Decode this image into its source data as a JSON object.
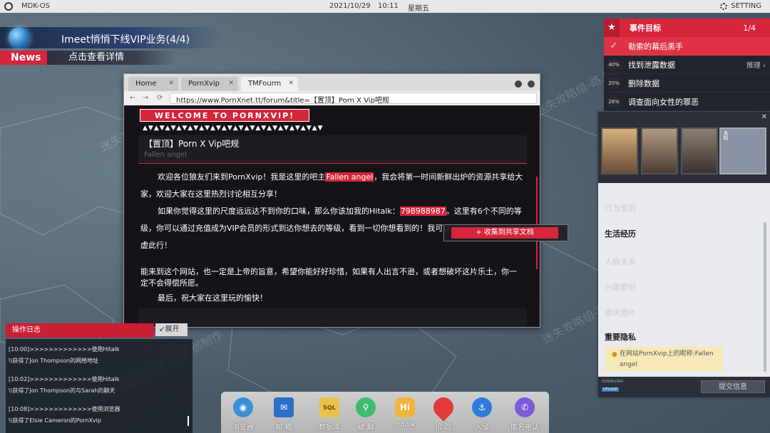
{
  "topbar": {
    "os_name": "MDK-OS",
    "date": "2021/10/29",
    "time": "10:11",
    "day": "星期五",
    "setting_label": "SETTING"
  },
  "news": {
    "title": "Imeet悄悄下线VIP业务(4/4)",
    "tag": "News",
    "subtitle": "点击查看详情"
  },
  "goals": {
    "header": "事件目标",
    "count": "1/4",
    "items": [
      {
        "badge": "✓",
        "label": "勒索的幕后黑手",
        "active": true
      },
      {
        "badge": "40%",
        "label": "找到泄露数据",
        "hint": "推理 ›"
      },
      {
        "badge": "20%",
        "label": "删除数据"
      },
      {
        "badge": "28%",
        "label": "调查面向女性的罪恶"
      }
    ]
  },
  "browser": {
    "tabs": [
      "Home",
      "PornXvip",
      "TMFourm"
    ],
    "url": "https://www.PornXnet.tt/forum&title=【置顶】Porn X Vip吧规",
    "banner": "WELCOME TO PORNXVIP!",
    "triangles": "▲▼▲▼▲▼▲▼▲▼▲▼▲▼▲▼▲▼▲▼▲▼▲▼▲▼▲▼▲▼▲▼",
    "post_title": "【置顶】Porn X Vip吧规",
    "post_author": "Fallen angel",
    "para1_a": "欢迎各位狼友们来到PornXvip！我是这里的吧主",
    "para1_hl": "Fallen angel",
    "para1_b": "，我会将第一时间新鲜出炉的资源共享给大",
    "para1_c": "家，欢迎大家在这里热烈讨论相互分享！",
    "para2_a": "如果你觉得这里的尺度远远达不到你的口味，那么你该加我的Hitalk：",
    "para2_hl": "798988987",
    "para2_b": "。这里有6个不同的等",
    "para2_c": "级，你可以通过充值成为VIP会员的形式到达你想去的等级，看到一切你想看到的！我可以",
    "para2_d": "虚此行！",
    "para3_a": "能来到这个网站，也一定是上帝的旨意，希望你能好好珍惜，如果有人出言不逊，或者想破坏这片乐土，你一",
    "para3_b": "定不会得偿所愿。",
    "para4": "最后，祝大家在这里玩的愉快！",
    "context_menu": "+ 收集到共享文档"
  },
  "char_panel": {
    "portrait_tag": "未知",
    "sec_basic": "行为准则",
    "sec_life": "生活经历",
    "sec_relations": "人脉关系",
    "sec_hobby": "兴趣爱好",
    "sec_photos": "相关图片",
    "sec_secret": "重要隐私",
    "secret_text": "在网站PornXvip上的昵称:Fallen angel",
    "download": "DOWNLOAD",
    "upload": "UPLOAD",
    "submit": "提交信息"
  },
  "log": {
    "header": "操作日志",
    "expand": "↙展开",
    "lines": [
      "[10:00]>>>>>>>>>>>>>使用Hitalk",
      "\\\\获得了Jon Thompson的网络地址",
      "[10:02]>>>>>>>>>>>>>使用Hitalk",
      "\\\\获得了Jon Thompson的与Sarah的聊天",
      "[10:08]>>>>>>>>>>>>>使用浏览器",
      "\\\\获得了Elsie Cameron的PornXvip"
    ]
  },
  "dock": [
    {
      "label": "浏览器",
      "icon": "globe-icon",
      "color": "#3a8fd8"
    },
    {
      "label": "邮 箱",
      "icon": "mail-icon",
      "color": "#2c6fc8"
    },
    {
      "label": "数据库",
      "icon": "sql-icon",
      "color": "#e8c34a"
    },
    {
      "label": "破 解",
      "icon": "lock-icon",
      "color": "#3dbb6e"
    },
    {
      "label": "Hitalk",
      "icon": "chat-icon",
      "color": "#f2b33d"
    },
    {
      "label": "追 踪",
      "icon": "pin-icon",
      "color": "#e03a3a"
    },
    {
      "label": "入侵",
      "icon": "hook-icon",
      "color": "#2f7bdc"
    },
    {
      "label": "匿名电话",
      "icon": "phone-icon",
      "color": "#7b5bd6"
    }
  ],
  "watermark": "迷失攻略组-路人a原创制作"
}
